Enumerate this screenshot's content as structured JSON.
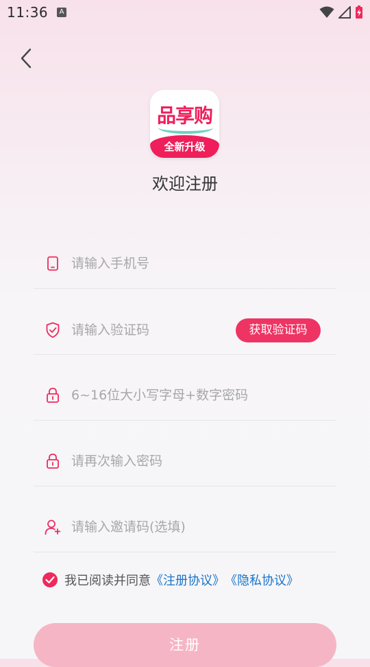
{
  "status": {
    "time": "11:36",
    "indicator": "A"
  },
  "logo": {
    "top_text": "品享购",
    "bottom_text": "全新升级"
  },
  "title": "欢迎注册",
  "fields": {
    "phone": {
      "placeholder": "请输入手机号",
      "icon": "phone-icon"
    },
    "code": {
      "placeholder": "请输入验证码",
      "icon": "shield-check-icon",
      "button": "获取验证码"
    },
    "password": {
      "placeholder": "6~16位大小写字母+数字密码",
      "icon": "lock-icon"
    },
    "confirm": {
      "placeholder": "请再次输入密码",
      "icon": "lock-icon"
    },
    "invite": {
      "placeholder": "请输入邀请码(选填)",
      "icon": "user-add-icon"
    }
  },
  "agreement": {
    "checked": true,
    "prefix": "我已阅读并同意",
    "link1": "《注册协议》",
    "link2": "《隐私协议》"
  },
  "submit_label": "注册",
  "colors": {
    "accent": "#ee2a5c",
    "link": "#1a73c8",
    "button_disabled": "#f6b5c5"
  }
}
